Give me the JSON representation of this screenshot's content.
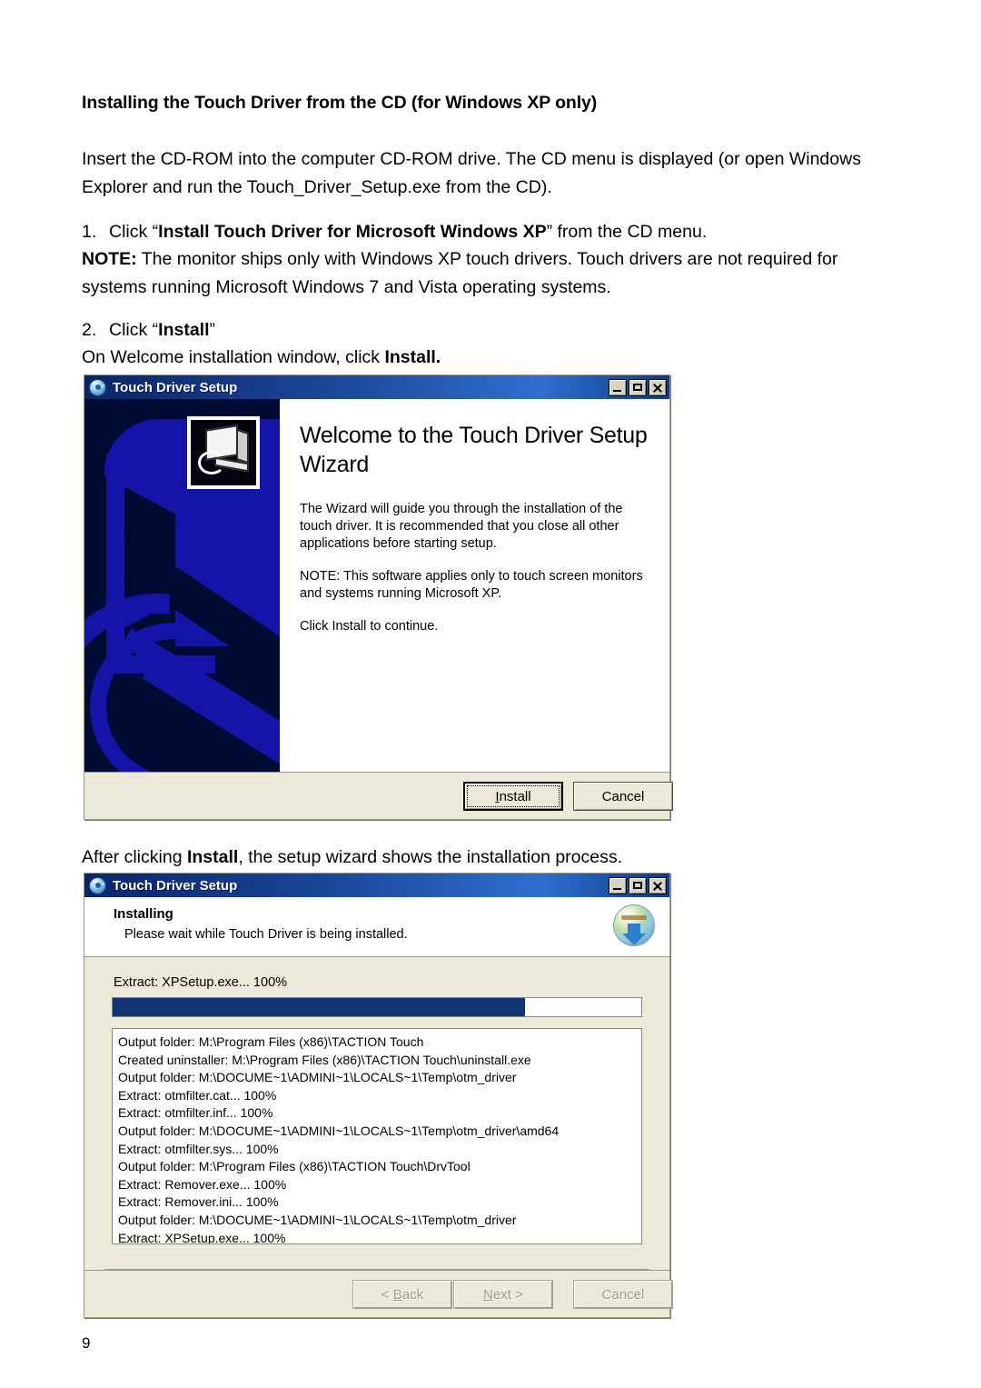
{
  "document": {
    "heading": "Installing the Touch Driver from the CD (for Windows XP only)",
    "intro": "Insert the CD-ROM into the computer CD-ROM drive. The CD menu is displayed (or open Windows Explorer and run the Touch_Driver_Setup.exe from the CD).",
    "step1": {
      "number": "1.",
      "text_before": "Click “",
      "bold": "Install Touch Driver for Microsoft Windows XP",
      "text_after": "” from the CD menu."
    },
    "note": {
      "label": "NOTE:",
      "text": " The monitor ships only with Windows XP touch drivers. Touch drivers are not required for systems running Microsoft Windows 7 and Vista operating systems."
    },
    "step2": {
      "number": "2.",
      "text_before": "Click “",
      "bold": "Install",
      "text_after": "”"
    },
    "step2_sub": {
      "text_before": "On Welcome installation window, click ",
      "bold": "Install."
    },
    "after_caption": {
      "text_before": "After clicking ",
      "bold": "Install",
      "text_after": ", the setup wizard shows the installation process."
    },
    "page_number": "9"
  },
  "dialog_welcome": {
    "title": "Touch Driver Setup",
    "title_icon": "installer-globe-icon",
    "window_buttons": [
      "minimize",
      "maximize",
      "close"
    ],
    "sidebar_icon": "touch-monitor-icon",
    "heading": "Welcome to the Touch Driver Setup Wizard",
    "paragraphs": [
      "The Wizard will guide you through the installation of the touch driver. It is recommended that you close all other applications before starting setup.",
      "NOTE: This software applies only to touch screen monitors and systems running Microsoft XP.",
      "Click Install to continue."
    ],
    "buttons": {
      "install": {
        "label": "Install",
        "accesskey": "I",
        "default": true
      },
      "cancel": {
        "label": "Cancel",
        "default": false
      }
    }
  },
  "dialog_installing": {
    "title": "Touch Driver Setup",
    "title_icon": "installer-globe-icon",
    "window_buttons": [
      "minimize",
      "maximize",
      "close"
    ],
    "header_title": "Installing",
    "header_subtitle": "Please wait while Touch Driver is being installed.",
    "header_icon": "nsis-globe-download-icon",
    "progress_label": "Extract: XPSetup.exe... 100%",
    "progress_percent": 78,
    "progress_fill_color": "#123474",
    "log_lines": [
      "Output folder: M:\\Program Files (x86)\\TACTION Touch",
      "Created uninstaller: M:\\Program Files (x86)\\TACTION Touch\\uninstall.exe",
      "Output folder: M:\\DOCUME~1\\ADMINI~1\\LOCALS~1\\Temp\\otm_driver",
      "Extract: otmfilter.cat... 100%",
      "Extract: otmfilter.inf... 100%",
      "Output folder: M:\\DOCUME~1\\ADMINI~1\\LOCALS~1\\Temp\\otm_driver\\amd64",
      "Extract: otmfilter.sys... 100%",
      "Output folder: M:\\Program Files (x86)\\TACTION Touch\\DrvTool",
      "Extract: Remover.exe... 100%",
      "Extract: Remover.ini... 100%",
      "Output folder: M:\\DOCUME~1\\ADMINI~1\\LOCALS~1\\Temp\\otm_driver",
      "Extract: XPSetup.exe... 100%"
    ],
    "buttons": {
      "back": {
        "label": "< Back",
        "accesskey": "B",
        "disabled": true
      },
      "next": {
        "label": "Next >",
        "accesskey": "N",
        "disabled": true
      },
      "cancel": {
        "label": "Cancel",
        "disabled": true
      }
    }
  }
}
